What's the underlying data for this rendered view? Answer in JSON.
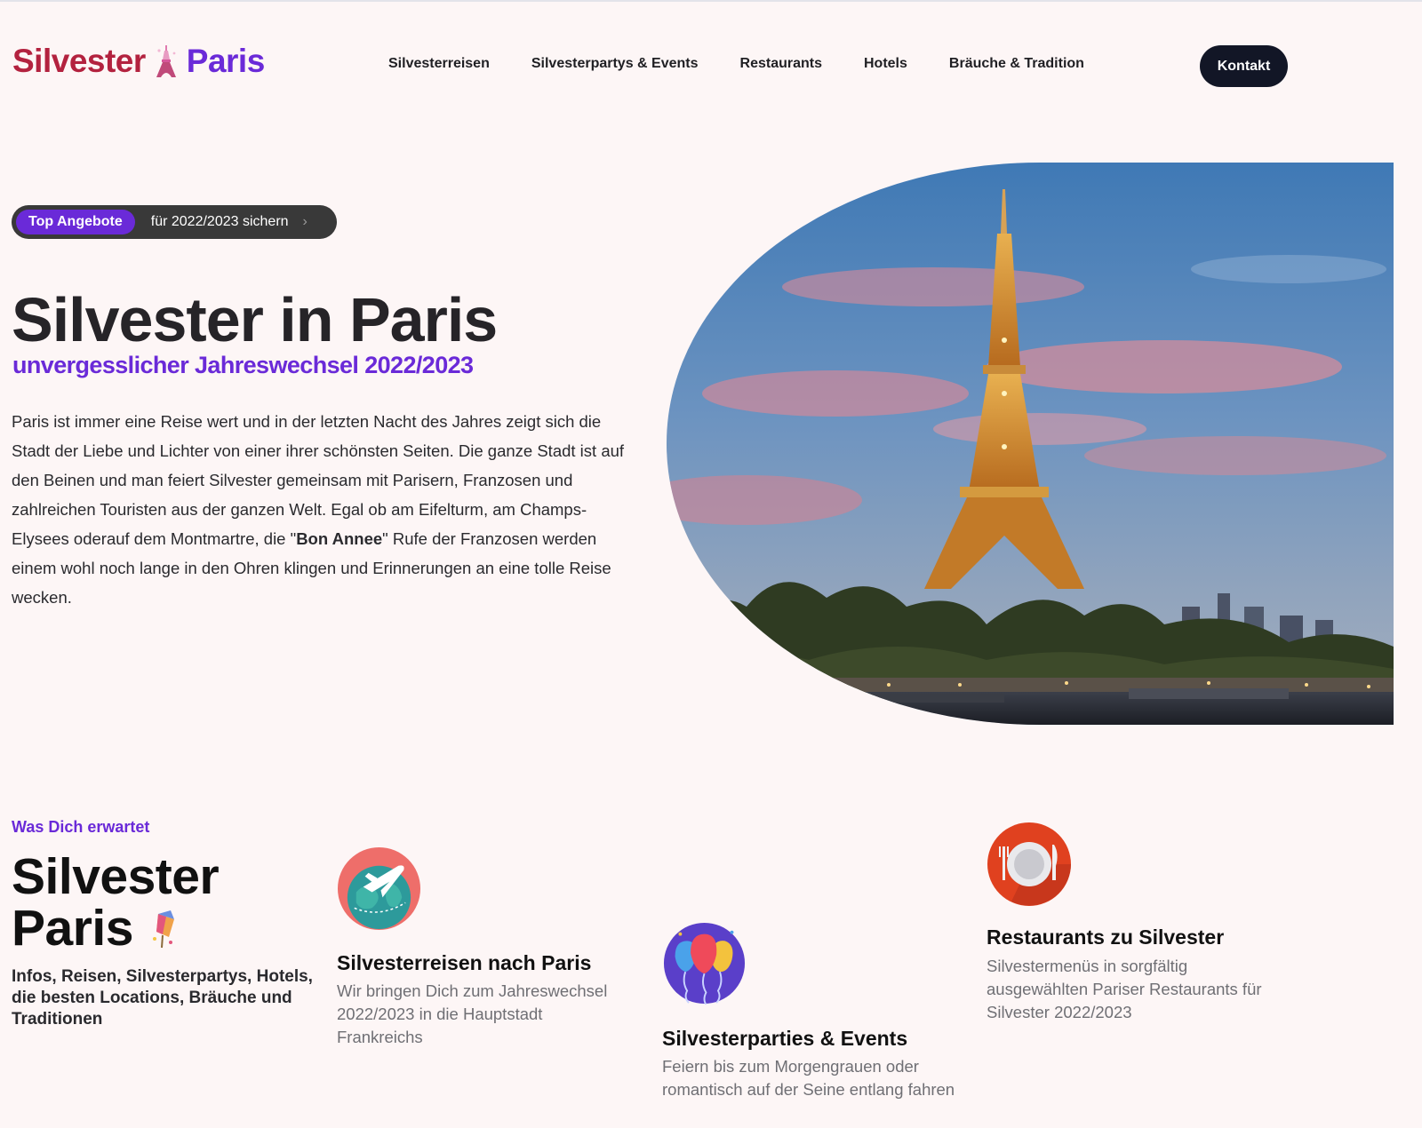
{
  "header": {
    "logo_word1": "Silvester",
    "logo_word2": "Paris",
    "nav": [
      "Silvesterreisen",
      "Silvesterpartys & Events",
      "Restaurants",
      "Hotels",
      "Bräuche & Tradition"
    ],
    "contact_label": "Kontakt"
  },
  "hero": {
    "badge_tag": "Top Angebote",
    "badge_text": "für 2022/2023 sichern",
    "title": "Silvester in Paris",
    "subtitle": "unvergesslicher Jahreswechsel 2022/2023",
    "text_before": "Paris ist immer eine Reise wert und in der letzten Nacht des Jahres zeigt sich die Stadt der Liebe und Lichter von einer ihrer schönsten Seiten. Die ganze Stadt ist auf den Beinen und man feiert Silvester gemeinsam mit Parisern, Franzosen und zahlreichen Touristen aus der ganzen Welt. Egal ob am Eifelturm, am Champs-Elysees oderauf dem Montmartre, die \"",
    "text_bold": "Bon Annee",
    "text_after": "\" Rufe der Franzosen werden einem wohl noch lange in den Ohren klingen und Erinnerungen an eine tolle Reise wecken."
  },
  "features": {
    "eyebrow": "Was Dich erwartet",
    "title_line1": "Silvester",
    "title_line2": "Paris",
    "description": "Infos, Reisen, Silvesterpartys, Hotels, die besten Locations, Bräuche und Traditionen",
    "cards": [
      {
        "icon": "globe-plane-icon",
        "title": "Silvesterreisen nach Paris",
        "text": "Wir bringen Dich zum Jahreswechsel 2022/2023 in die Hauptstadt Frankreichs"
      },
      {
        "icon": "balloons-icon",
        "title": "Silvesterparties & Events",
        "text": "Feiern bis zum Morgengrauen oder romantisch auf der Seine entlang fahren"
      },
      {
        "icon": "plate-cutlery-icon",
        "title": "Restaurants zu Silvester",
        "text": "Silvestermenüs in sorgfältig ausgewählten Pariser Restaurants für Silvester 2022/2023"
      }
    ]
  },
  "colors": {
    "accent_purple": "#6a2ad8",
    "logo_red": "#b3223f",
    "button_dark": "#121626",
    "background": "#fdf6f6"
  }
}
